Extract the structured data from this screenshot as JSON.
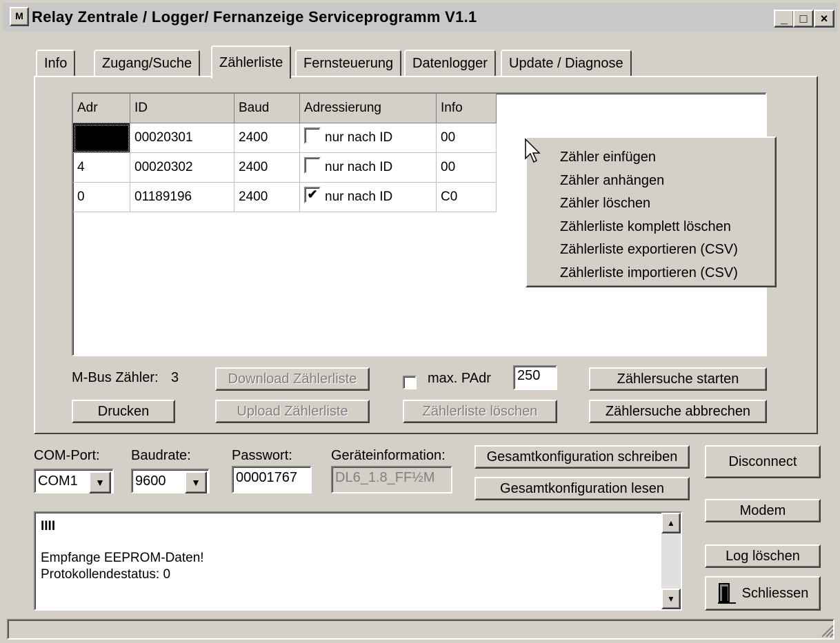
{
  "window": {
    "title": "Relay Zentrale / Logger/ Fernanzeige Serviceprogramm V1.1",
    "buttons": {
      "minimize": "_",
      "maximize": "□",
      "close": "×"
    }
  },
  "tabs": [
    "Info",
    "Zugang/Suche",
    "Zählerliste",
    "Fernsteuerung",
    "Datenlogger",
    "Update / Diagnose"
  ],
  "active_tab": "Zählerliste",
  "table": {
    "columns": [
      "Adr",
      "ID",
      "Baud",
      "Adressierung",
      "Info"
    ],
    "rows": [
      {
        "adr": "",
        "id": "00020301",
        "baud": "2400",
        "checked": false,
        "addr_label": "nur nach ID",
        "info": "00"
      },
      {
        "adr": "4",
        "id": "00020302",
        "baud": "2400",
        "checked": false,
        "addr_label": "nur nach ID",
        "info": "00"
      },
      {
        "adr": "0",
        "id": "01189196",
        "baud": "2400",
        "checked": true,
        "addr_label": "nur nach ID",
        "info": "C0"
      }
    ]
  },
  "context_menu": [
    "Zähler einfügen",
    "Zähler anhängen",
    "Zähler löschen",
    "Zählerliste komplett löschen",
    "Zählerliste exportieren (CSV)",
    "Zählerliste importieren (CSV)"
  ],
  "meter_count_label": "M-Bus Zähler:",
  "meter_count": "3",
  "buttons": {
    "download": "Download Zählerliste",
    "upload": "Upload Zählerliste",
    "print": "Drucken",
    "clear_list": "Zählerliste löschen",
    "search_start": "Zählersuche starten",
    "search_abort": "Zählersuche abbrechen",
    "write_config": "Gesamtkonfiguration schreiben",
    "read_config": "Gesamtkonfiguration lesen",
    "disconnect": "Disconnect",
    "modem": "Modem",
    "log_clear": "Log löschen",
    "close": "Schliessen"
  },
  "max_padr": {
    "label": "max. PAdr",
    "value": "250",
    "checked": false
  },
  "com_port": {
    "label": "COM-Port:",
    "value": "COM1"
  },
  "baudrate": {
    "label": "Baudrate:",
    "value": "9600"
  },
  "password": {
    "label": "Passwort:",
    "value": "00001767"
  },
  "device_info": {
    "label": "Geräteinformation:",
    "value": "DL6_1.8_FF½M"
  },
  "log": {
    "marker": "IIII",
    "lines": [
      "Empfange EEPROM-Daten!",
      "Protokollendestatus: 0"
    ]
  }
}
